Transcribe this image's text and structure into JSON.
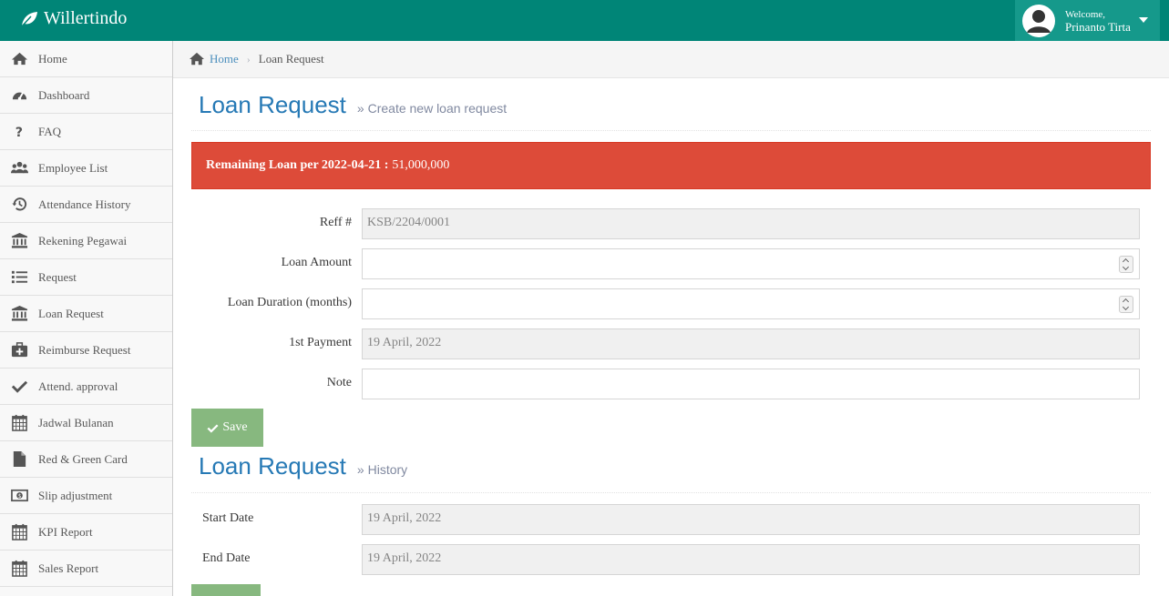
{
  "brand": {
    "name": "Willertindo",
    "icon": "leaf-icon"
  },
  "user": {
    "welcome": "Welcome,",
    "name": "Prinanto Tirta"
  },
  "sidebar": {
    "items": [
      {
        "label": "Home",
        "icon": "home-icon"
      },
      {
        "label": "Dashboard",
        "icon": "dashboard-icon"
      },
      {
        "label": "FAQ",
        "icon": "question-icon"
      },
      {
        "label": "Employee List",
        "icon": "users-icon"
      },
      {
        "label": "Attendance History",
        "icon": "history-icon"
      },
      {
        "label": "Rekening Pegawai",
        "icon": "bank-icon"
      },
      {
        "label": "Request",
        "icon": "list-icon"
      },
      {
        "label": "Loan Request",
        "icon": "bank-icon"
      },
      {
        "label": "Reimburse Request",
        "icon": "medkit-icon"
      },
      {
        "label": "Attend. approval",
        "icon": "check-icon"
      },
      {
        "label": "Jadwal Bulanan",
        "icon": "calendar-icon"
      },
      {
        "label": "Red & Green Card",
        "icon": "file-icon"
      },
      {
        "label": "Slip adjustment",
        "icon": "money-icon"
      },
      {
        "label": "KPI Report",
        "icon": "calendar-icon"
      },
      {
        "label": "Sales Report",
        "icon": "calendar-icon"
      }
    ]
  },
  "breadcrumb": {
    "home": "Home",
    "current": "Loan Request"
  },
  "create_section": {
    "title": "Loan Request",
    "subtitle": "Create new loan request"
  },
  "alert": {
    "label": "Remaining Loan per 2022-04-21 :",
    "value": "51,000,000"
  },
  "form": {
    "reff": {
      "label": "Reff #",
      "value": "KSB/2204/0001"
    },
    "loan_amount": {
      "label": "Loan Amount",
      "value": ""
    },
    "loan_duration": {
      "label": "Loan Duration (months)",
      "value": ""
    },
    "first_payment": {
      "label": "1st Payment",
      "value": "19 April, 2022"
    },
    "note": {
      "label": "Note",
      "value": ""
    },
    "save_label": "Save"
  },
  "history_section": {
    "title": "Loan Request",
    "subtitle": "History"
  },
  "history_form": {
    "start_date": {
      "label": "Start Date",
      "value": "19 April, 2022"
    },
    "end_date": {
      "label": "End Date",
      "value": "19 April, 2022"
    }
  },
  "colors": {
    "navbar": "#008577",
    "accent": "#2679b5",
    "alert": "#dd4b39",
    "success": "#87b87f"
  }
}
